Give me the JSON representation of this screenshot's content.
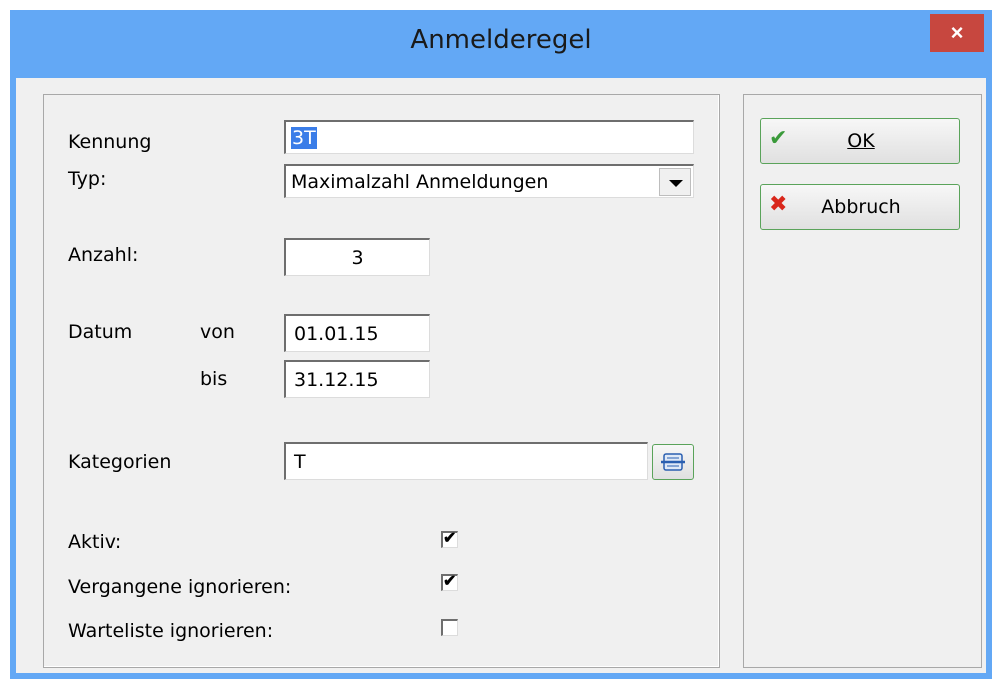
{
  "window": {
    "title": "Anmelderegel",
    "close_glyph": "×"
  },
  "form": {
    "kennung_label": "Kennung",
    "kennung_value": "3T",
    "typ_label": "Typ:",
    "typ_value": "Maximalzahl Anmeldungen",
    "anzahl_label": "Anzahl:",
    "anzahl_value": "3",
    "datum_label": "Datum",
    "von_label": "von",
    "von_value": "01.01.15",
    "bis_label": "bis",
    "bis_value": "31.12.15",
    "kategorien_label": "Kategorien",
    "kategorien_value": "T",
    "aktiv_label": "Aktiv:",
    "aktiv_checked": true,
    "vergangene_label": "Vergangene ignorieren:",
    "vergangene_checked": true,
    "warteliste_label": "Warteliste ignorieren:",
    "warteliste_checked": false
  },
  "buttons": {
    "ok_label": "OK",
    "cancel_label": "Abbruch",
    "ok_icon": "check-icon",
    "cancel_icon": "x-icon"
  },
  "colors": {
    "titlebar": "#63a8f5",
    "close": "#c7473f",
    "selection": "#3a7de8",
    "check_green": "#3a9a3a",
    "cancel_red": "#d9271b"
  }
}
